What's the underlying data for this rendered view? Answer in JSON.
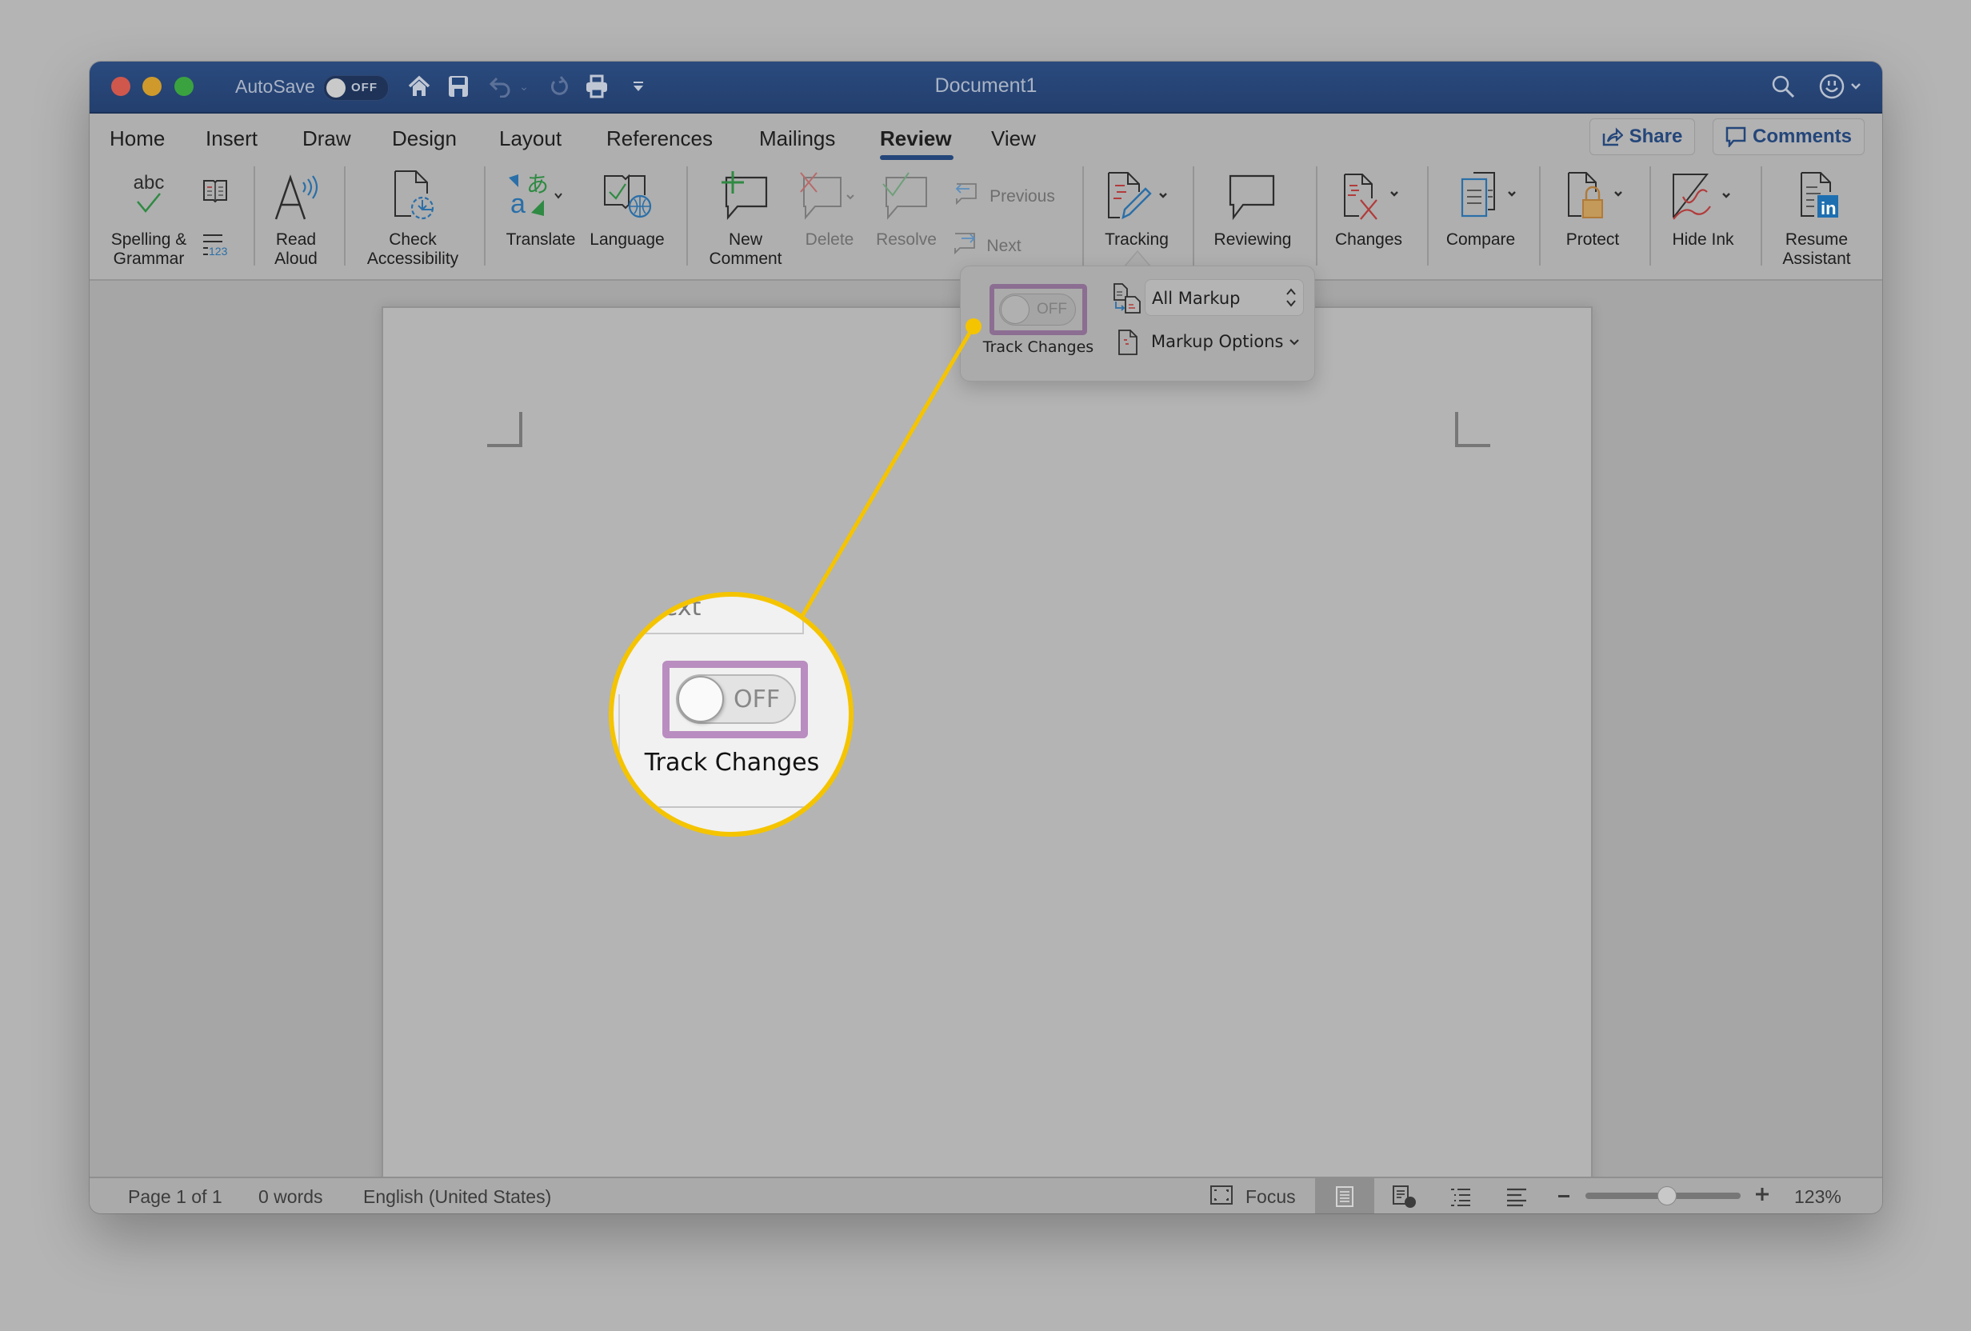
{
  "window": {
    "title": "Document1",
    "autosave_label": "AutoSave",
    "autosave_state": "OFF"
  },
  "tabs": [
    {
      "label": "Home"
    },
    {
      "label": "Insert"
    },
    {
      "label": "Draw"
    },
    {
      "label": "Design"
    },
    {
      "label": "Layout"
    },
    {
      "label": "References"
    },
    {
      "label": "Mailings"
    },
    {
      "label": "Review",
      "active": true
    },
    {
      "label": "View"
    }
  ],
  "header_buttons": {
    "share": "Share",
    "comments": "Comments"
  },
  "ribbon": {
    "spelling": [
      "Spelling &",
      "Grammar"
    ],
    "read_aloud": [
      "Read",
      "Aloud"
    ],
    "check_accessibility": [
      "Check",
      "Accessibility"
    ],
    "translate": "Translate",
    "language": "Language",
    "new_comment": [
      "New",
      "Comment"
    ],
    "delete": "Delete",
    "resolve": "Resolve",
    "previous": "Previous",
    "next": "Next",
    "tracking": "Tracking",
    "reviewing": "Reviewing",
    "changes": "Changes",
    "compare": "Compare",
    "protect": "Protect",
    "hide_ink": "Hide Ink",
    "resume_assistant": [
      "Resume",
      "Assistant"
    ],
    "word_count_small_icon": "123"
  },
  "tracking_popover": {
    "track_changes_label": "Track Changes",
    "track_changes_state": "OFF",
    "markup_view_value": "All Markup",
    "markup_options_label": "Markup Options"
  },
  "magnifier": {
    "partial_text": "ext",
    "toggle_state": "OFF",
    "label": "Track Changes"
  },
  "statusbar": {
    "page": "Page 1 of 1",
    "words": "0 words",
    "language": "English (United States)",
    "focus": "Focus",
    "zoom_level": "123%",
    "zoom_slider_fraction": 0.52
  },
  "colors": {
    "titlebar": "#24467a",
    "highlight_box": "#b98dc0",
    "callout": "#f5c400"
  }
}
